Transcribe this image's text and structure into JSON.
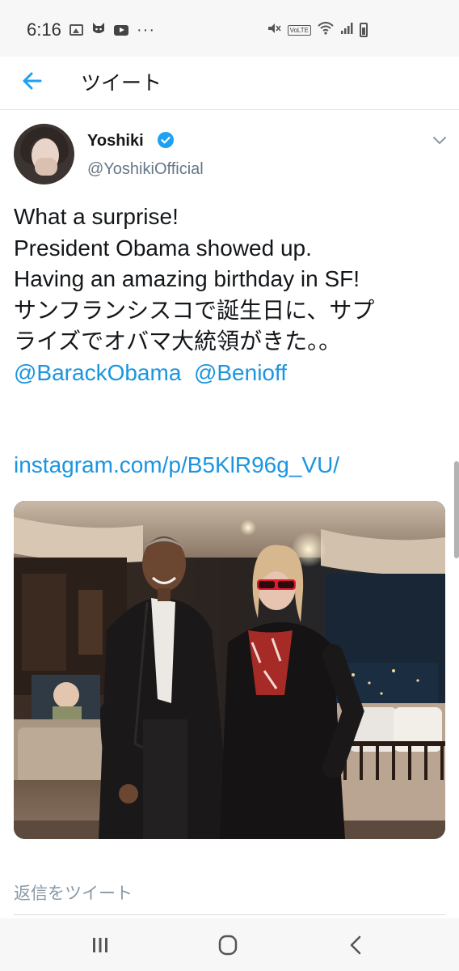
{
  "status_bar": {
    "time": "6:16",
    "left_icons": [
      "image-icon",
      "cat-icon",
      "youtube-icon",
      "more-dots-icon"
    ],
    "more_dots": "···",
    "volte_label": "VoLTE",
    "right_icons": [
      "mute-icon",
      "volte-icon",
      "wifi-icon",
      "signal-icon",
      "battery-icon"
    ]
  },
  "header": {
    "title": "ツイート",
    "back_icon": "arrow-left-icon"
  },
  "tweet": {
    "author_name": "Yoshiki",
    "author_handle": "@YoshikiOfficial",
    "text_lines": "What a surprise!\nPresident Obama showed up.\nHaving an amazing birthday in SF!\nサンフランシスコで誕生日に、サプ\nライズでオバマ大統領がきた。。",
    "mentions": [
      "@BarackObama",
      "@Benioff"
    ],
    "link": "instagram.com/p/B5KlR96g_VU/"
  },
  "reply": {
    "placeholder": "返信をツイート"
  },
  "colors": {
    "accent": "#1b95e0",
    "secondary_text": "#657786",
    "text": "#14171a"
  },
  "nav_icons": [
    "recents-icon",
    "home-icon",
    "back-icon"
  ]
}
